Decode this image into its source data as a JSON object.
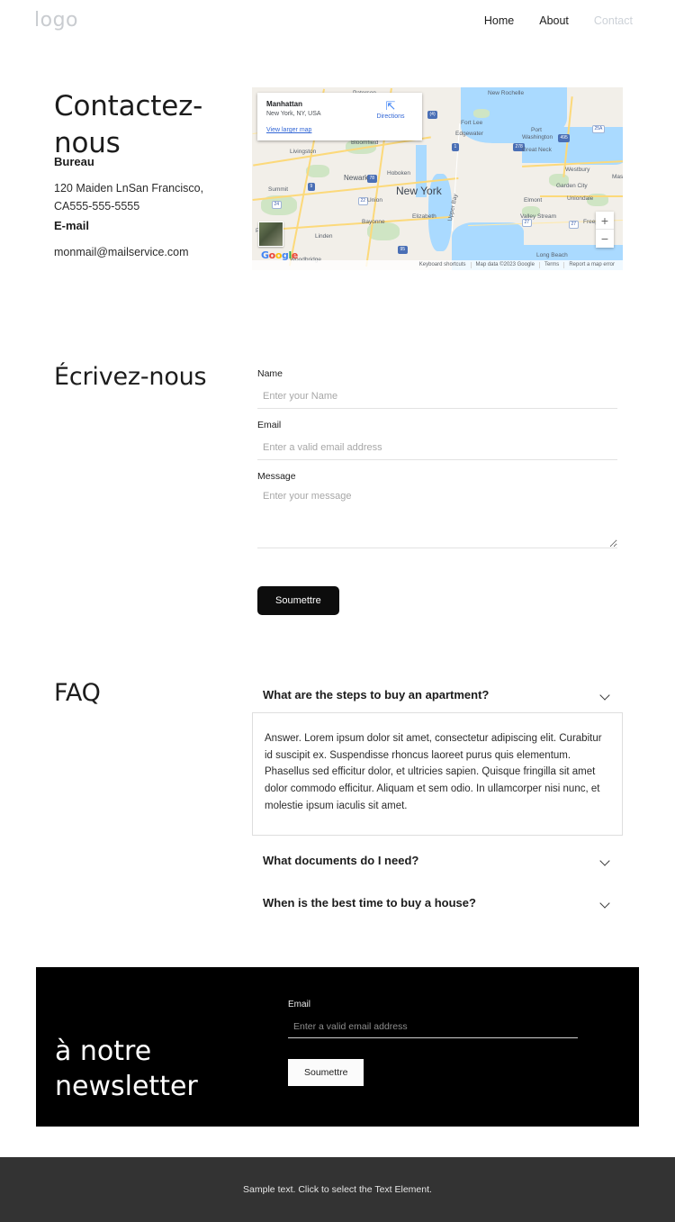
{
  "header": {
    "logo": "logo",
    "nav": [
      {
        "label": "Home",
        "muted": false
      },
      {
        "label": "About",
        "muted": false
      },
      {
        "label": "Contact",
        "muted": true
      }
    ]
  },
  "contact": {
    "heading": "Contactez-nous",
    "office_label": "Bureau",
    "office_text": "120 Maiden LnSan Francisco, CA555-555-5555",
    "email_label": "E-mail",
    "email_text": "monmail@mailservice.com"
  },
  "map": {
    "card": {
      "title": "Manhattan",
      "subtitle": "New York, NY, USA",
      "larger_map_link": "View larger map",
      "directions_label": "Directions"
    },
    "zoom_in": "+",
    "zoom_out": "−",
    "brand": "Google",
    "footer_items": [
      "Keyboard shortcuts",
      "Map data ©2023 Google",
      "Terms",
      "Report a map error"
    ],
    "place_labels": [
      "Paterson",
      "New Rochelle",
      "Port Washington",
      "Great Neck",
      "Fort Lee",
      "Edgewater",
      "Westbury",
      "Garden City",
      "Uniondale",
      "Elmont",
      "Valley Stream",
      "Freeport",
      "Long Beach",
      "Bloomfield",
      "Livingston",
      "Newark",
      "Hoboken",
      "New York",
      "Summit",
      "Union",
      "Elizabeth",
      "Bayonne",
      "Linden",
      "Plainfield",
      "Upper Bay",
      "Woodbridge"
    ]
  },
  "write": {
    "heading": "Écrivez-nous",
    "fields": [
      {
        "label": "Name",
        "placeholder": "Enter your Name"
      },
      {
        "label": "Email",
        "placeholder": "Enter a valid email address"
      },
      {
        "label": "Message",
        "placeholder": "Enter your message"
      }
    ],
    "submit_label": "Soumettre"
  },
  "faq": {
    "heading": "FAQ",
    "items": [
      {
        "question": "What are the steps to buy an apartment?",
        "answer": "Answer. Lorem ipsum dolor sit amet, consectetur adipiscing elit. Curabitur id suscipit ex. Suspendisse rhoncus laoreet purus quis elementum. Phasellus sed efficitur dolor, et ultricies sapien. Quisque fringilla sit amet dolor commodo efficitur. Aliquam et sem odio. In ullamcorper nisi nunc, et molestie ipsum iaculis sit amet.",
        "open": true
      },
      {
        "question": "What documents do I need?",
        "answer": "",
        "open": false
      },
      {
        "question": "When is the best time to buy a house?",
        "answer": "",
        "open": false
      }
    ]
  },
  "newsletter": {
    "heading_line1": "à notre",
    "heading_line2": "newsletter",
    "email_label": "Email",
    "email_placeholder": "Enter a valid email address",
    "submit_label": "Soumettre"
  },
  "footer": {
    "text": "Sample text. Click to select the Text Element."
  },
  "colors": {
    "accent_dark": "#0d0d0d",
    "footer_bg": "#333333",
    "muted_nav": "#cdd2d8",
    "map_link": "#3367d6"
  }
}
